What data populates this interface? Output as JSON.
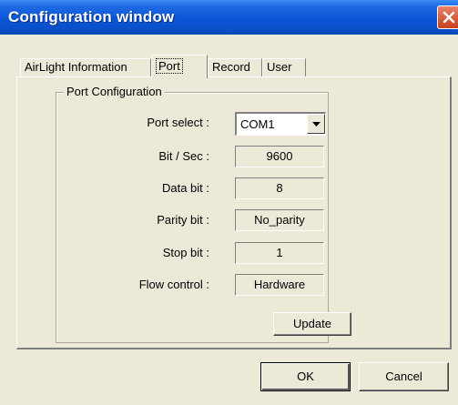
{
  "window": {
    "title": "Configuration window"
  },
  "tabs": [
    {
      "label": "AirLight Information"
    },
    {
      "label": "Port"
    },
    {
      "label": "Record"
    },
    {
      "label": "User"
    }
  ],
  "active_tab": "Port",
  "group": {
    "title": "Port Configuration",
    "port_select": {
      "label": "Port select :",
      "value": "COM1"
    },
    "bit_sec": {
      "label": "Bit / Sec :",
      "value": "9600"
    },
    "data_bit": {
      "label": "Data bit :",
      "value": "8"
    },
    "parity_bit": {
      "label": "Parity bit :",
      "value": "No_parity"
    },
    "stop_bit": {
      "label": "Stop bit :",
      "value": "1"
    },
    "flow_control": {
      "label": "Flow control :",
      "value": "Hardware"
    }
  },
  "buttons": {
    "update": "Update",
    "ok": "OK",
    "cancel": "Cancel"
  },
  "colors": {
    "title_bar": "#0a55d6",
    "dialog_bg": "#ece9d8",
    "close_button": "#c8401e"
  },
  "icons": {
    "close": "close-icon",
    "dropdown": "chevron-down-icon"
  }
}
